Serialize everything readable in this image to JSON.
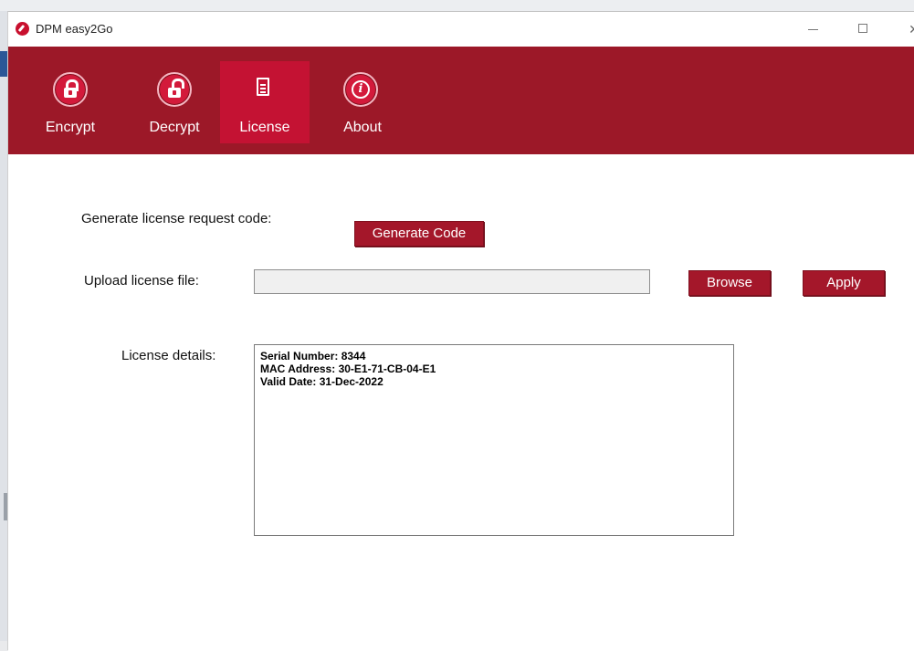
{
  "window": {
    "title": "DPM easy2Go",
    "controls": {
      "minimize": "minimize",
      "maximize": "maximize",
      "close": "close"
    }
  },
  "toolbar": {
    "items": [
      {
        "label": "Encrypt",
        "icon": "lock-closed-icon",
        "active": false
      },
      {
        "label": "Decrypt",
        "icon": "lock-open-icon",
        "active": false
      },
      {
        "label": "License",
        "icon": "document-icon",
        "active": true
      },
      {
        "label": "About",
        "icon": "info-icon",
        "active": false
      }
    ]
  },
  "license": {
    "generate_label": "Generate license request code:",
    "generate_button": "Generate Code",
    "upload_label": "Upload license file:",
    "upload_value": "",
    "browse_button": "Browse",
    "apply_button": "Apply",
    "details_label": "License details:",
    "details_lines": [
      "Serial Number: 8344",
      "MAC Address: 30-E1-71-CB-04-E1",
      "Valid Date: 31-Dec-2022"
    ]
  },
  "colors": {
    "toolbar_bg": "#9c1828",
    "active_tab_bg": "#c41233",
    "button_bg": "#a4172a"
  }
}
